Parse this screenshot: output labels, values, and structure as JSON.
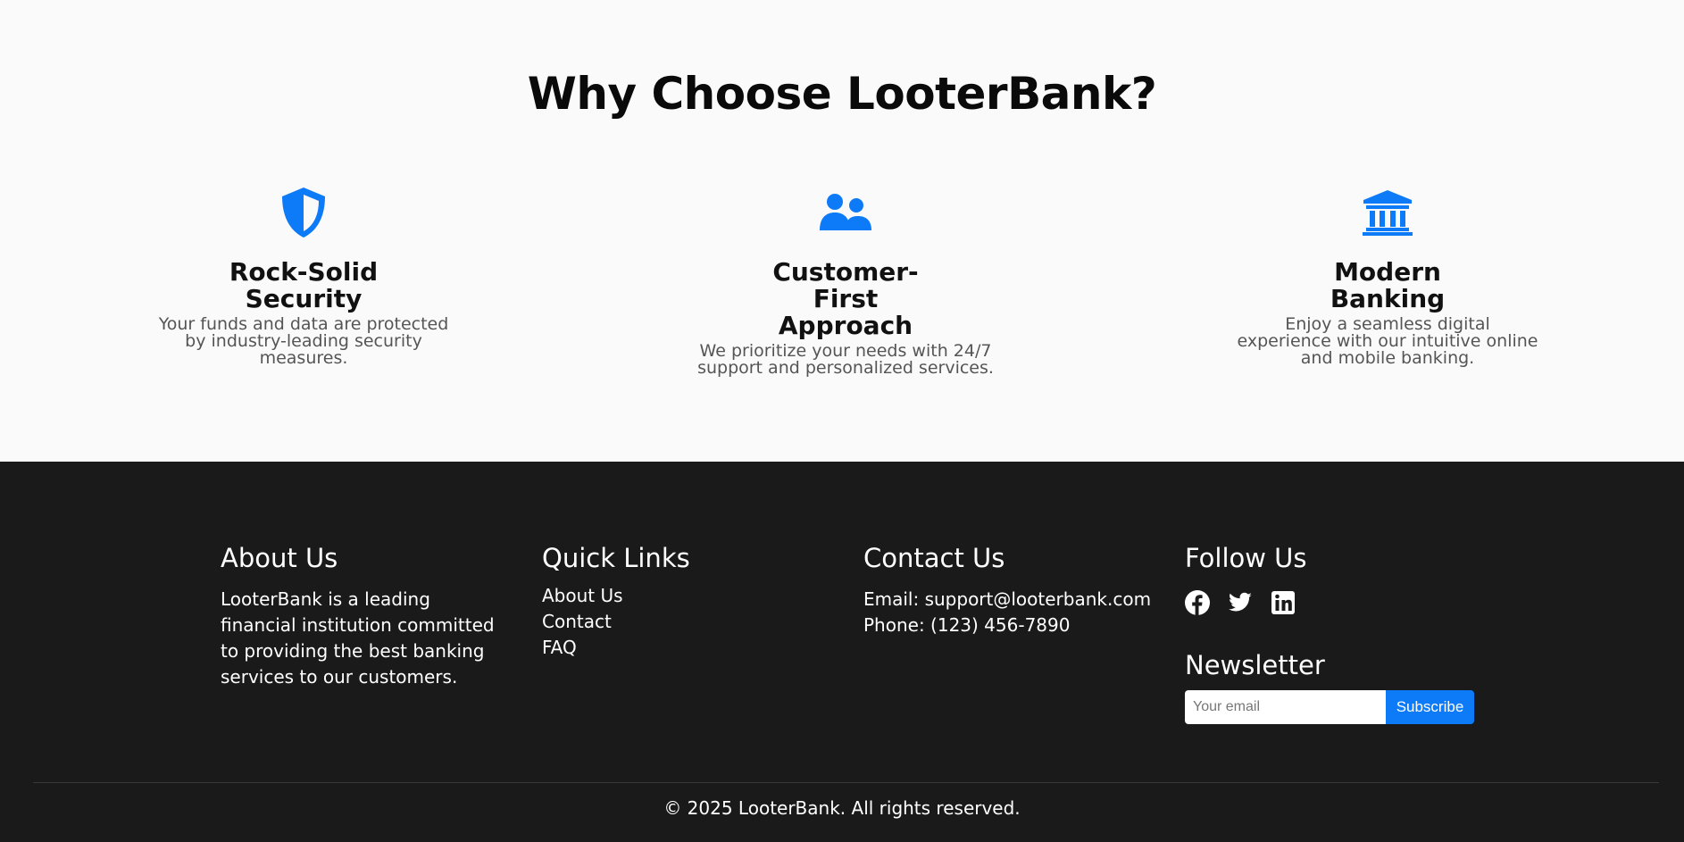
{
  "why": {
    "title": "Why Choose LooterBank?",
    "accent_color": "#0d7bf8",
    "features": [
      {
        "icon": "shield-icon",
        "title": "Rock-Solid Security",
        "text": "Your funds and data are protected by industry-leading security measures."
      },
      {
        "icon": "users-icon",
        "title": "Customer-First Approach",
        "text": "We prioritize your needs with 24/7 support and personalized services."
      },
      {
        "icon": "bank-icon",
        "title": "Modern Banking",
        "text": "Enjoy a seamless digital experience with our intuitive online and mobile banking."
      }
    ]
  },
  "footer": {
    "background_color": "#1a1a1a",
    "about": {
      "heading": "About Us",
      "text": "LooterBank is a leading financial institution committed to providing the best banking services to our customers."
    },
    "quick_links": {
      "heading": "Quick Links",
      "items": [
        "About Us",
        "Contact",
        "FAQ"
      ]
    },
    "contact": {
      "heading": "Contact Us",
      "email": "Email: support@looterbank.com",
      "phone": "Phone: (123) 456-7890"
    },
    "follow": {
      "heading": "Follow Us",
      "icons": [
        "facebook-icon",
        "twitter-icon",
        "linkedin-icon"
      ]
    },
    "newsletter": {
      "heading": "Newsletter",
      "placeholder": "Your email",
      "button": "Subscribe"
    },
    "copyright": "© 2025 LooterBank. All rights reserved."
  }
}
